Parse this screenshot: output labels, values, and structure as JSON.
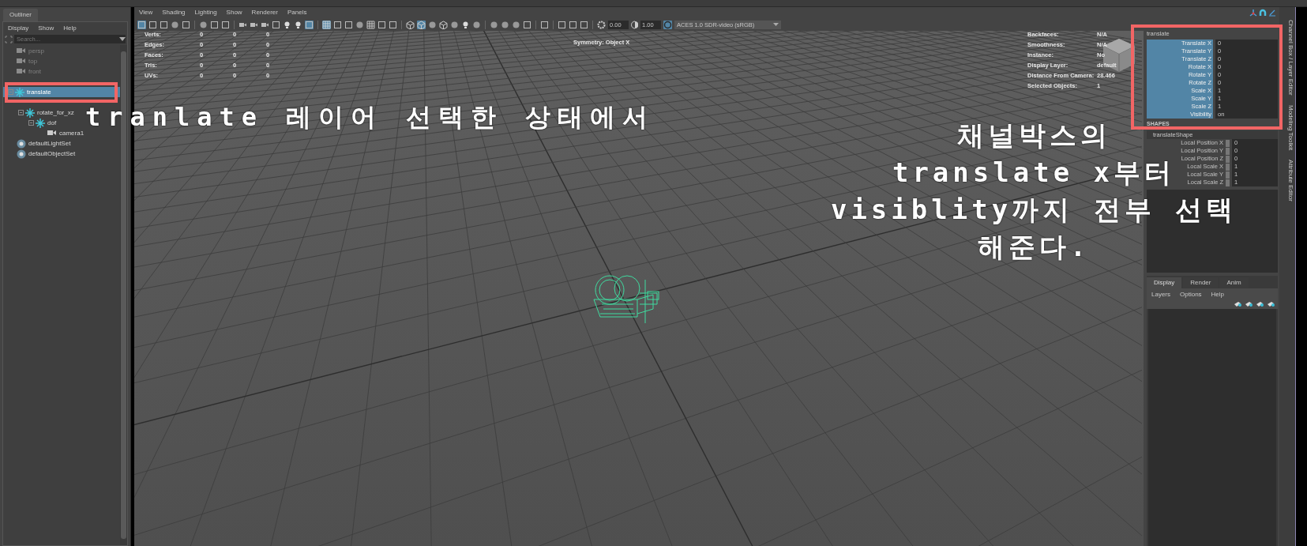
{
  "outliner": {
    "title": "Outliner",
    "menu": [
      "Display",
      "Show",
      "Help"
    ],
    "search": {
      "placeholder": "Search..."
    },
    "items": [
      {
        "label": "persp",
        "kind": "camera",
        "hidden": true,
        "selected": false
      },
      {
        "label": "top",
        "kind": "camera",
        "hidden": true,
        "selected": false
      },
      {
        "label": "front",
        "kind": "camera",
        "hidden": true,
        "selected": false
      },
      {
        "label": "translate",
        "kind": "transform",
        "hidden": false,
        "selected": true,
        "expanded": true,
        "children": [
          {
            "label": "rotate_for_xz",
            "kind": "transform",
            "hidden": false,
            "selected": false,
            "expanded": true,
            "children": [
              {
                "label": "dof",
                "kind": "transform",
                "hidden": false,
                "selected": false,
                "expanded": true,
                "children": [
                  {
                    "label": "camera1",
                    "kind": "camera",
                    "hidden": false,
                    "selected": false
                  }
                ]
              }
            ]
          }
        ]
      },
      {
        "label": "defaultLightSet",
        "kind": "set",
        "hidden": false,
        "selected": false
      },
      {
        "label": "defaultObjectSet",
        "kind": "set",
        "hidden": false,
        "selected": false
      }
    ]
  },
  "viewport": {
    "menu": [
      "View",
      "Shading",
      "Lighting",
      "Show",
      "Renderer",
      "Panels"
    ],
    "tools": [
      {
        "kind": "square",
        "on": true
      },
      {
        "kind": "square",
        "on": false
      },
      {
        "kind": "square",
        "on": false
      },
      {
        "kind": "circle",
        "on": false
      },
      {
        "kind": "square",
        "on": false
      },
      {
        "kind": "sep"
      },
      {
        "kind": "circle",
        "on": false
      },
      {
        "kind": "square",
        "on": false
      },
      {
        "kind": "square",
        "on": false
      },
      {
        "kind": "sep"
      },
      {
        "kind": "camera",
        "on": false
      },
      {
        "kind": "camera",
        "on": false
      },
      {
        "kind": "camera",
        "on": false
      },
      {
        "kind": "square",
        "on": false
      },
      {
        "kind": "light",
        "on": false
      },
      {
        "kind": "light",
        "on": false
      },
      {
        "kind": "square",
        "on": true
      },
      {
        "kind": "sep"
      },
      {
        "kind": "grid",
        "on": true
      },
      {
        "kind": "square",
        "on": false
      },
      {
        "kind": "square",
        "on": false
      },
      {
        "kind": "circle",
        "on": false
      },
      {
        "kind": "grid",
        "on": false
      },
      {
        "kind": "square",
        "on": false
      },
      {
        "kind": "square",
        "on": false
      },
      {
        "kind": "sep"
      },
      {
        "kind": "cube",
        "on": false
      },
      {
        "kind": "cube",
        "on": true
      },
      {
        "kind": "circle",
        "on": false
      },
      {
        "kind": "cube",
        "on": false
      },
      {
        "kind": "circle",
        "on": false
      },
      {
        "kind": "light",
        "on": false
      },
      {
        "kind": "circle",
        "on": false
      },
      {
        "kind": "sep"
      },
      {
        "kind": "circle",
        "on": false
      },
      {
        "kind": "circle",
        "on": false
      },
      {
        "kind": "circle",
        "on": false
      },
      {
        "kind": "square",
        "on": false
      },
      {
        "kind": "sep"
      },
      {
        "kind": "square",
        "on": false
      },
      {
        "kind": "sep"
      },
      {
        "kind": "square",
        "on": false
      },
      {
        "kind": "square",
        "on": false
      },
      {
        "kind": "square",
        "on": false
      },
      {
        "kind": "sep"
      }
    ],
    "exposure": "0.00",
    "gamma": "1.00",
    "color_space": "ACES 1.0 SDR-video (sRGB)",
    "stats": [
      {
        "label": "Verts:",
        "values": [
          "0",
          "0",
          "0"
        ]
      },
      {
        "label": "Edges:",
        "values": [
          "0",
          "0",
          "0"
        ]
      },
      {
        "label": "Faces:",
        "values": [
          "0",
          "0",
          "0"
        ]
      },
      {
        "label": "Tris:",
        "values": [
          "0",
          "0",
          "0"
        ]
      },
      {
        "label": "UVs:",
        "values": [
          "0",
          "0",
          "0"
        ]
      }
    ],
    "symmetry": "Symmetry: Object X",
    "info": [
      {
        "label": "Backfaces:",
        "value": "N/A"
      },
      {
        "label": "Smoothness:",
        "value": "N/A"
      },
      {
        "label": "Instance:",
        "value": "No"
      },
      {
        "label": "Display Layer:",
        "value": "default"
      },
      {
        "label": "Distance From Camera:",
        "value": "28.466"
      },
      {
        "label": "Selected Objects:",
        "value": "1"
      }
    ]
  },
  "channel_box": {
    "object": "translate",
    "channels": [
      {
        "name": "Translate X",
        "value": "0",
        "selected": true
      },
      {
        "name": "Translate Y",
        "value": "0",
        "selected": true
      },
      {
        "name": "Translate Z",
        "value": "0",
        "selected": true
      },
      {
        "name": "Rotate X",
        "value": "0",
        "selected": true
      },
      {
        "name": "Rotate Y",
        "value": "0",
        "selected": true
      },
      {
        "name": "Rotate Z",
        "value": "0",
        "selected": true
      },
      {
        "name": "Scale X",
        "value": "1",
        "selected": true
      },
      {
        "name": "Scale Y",
        "value": "1",
        "selected": true
      },
      {
        "name": "Scale Z",
        "value": "1",
        "selected": true
      },
      {
        "name": "Visibility",
        "value": "on",
        "selected": true
      }
    ],
    "shapes_header": "SHAPES",
    "shape": "translateShape",
    "shape_channels": [
      {
        "name": "Local Position X",
        "value": "0"
      },
      {
        "name": "Local Position Y",
        "value": "0"
      },
      {
        "name": "Local Position Z",
        "value": "0"
      },
      {
        "name": "Local Scale X",
        "value": "1"
      },
      {
        "name": "Local Scale Y",
        "value": "1"
      },
      {
        "name": "Local Scale Z",
        "value": "1"
      }
    ]
  },
  "layer_editor": {
    "tabs": [
      {
        "label": "Display",
        "selected": true
      },
      {
        "label": "Render",
        "selected": false
      },
      {
        "label": "Anim",
        "selected": false
      }
    ],
    "menu": [
      "Layers",
      "Options",
      "Help"
    ]
  },
  "side_tabs": [
    "Channel Box / Layer Editor",
    "Modeling Toolkit",
    "Attribute Editor"
  ],
  "annotations": [
    {
      "lines": [
        "tranlate 레이어 선택한 상태에서"
      ]
    },
    {
      "lines": [
        "채널박스의",
        "translate x부터",
        "visiblity까지 전부 선택",
        "해준다."
      ]
    }
  ]
}
